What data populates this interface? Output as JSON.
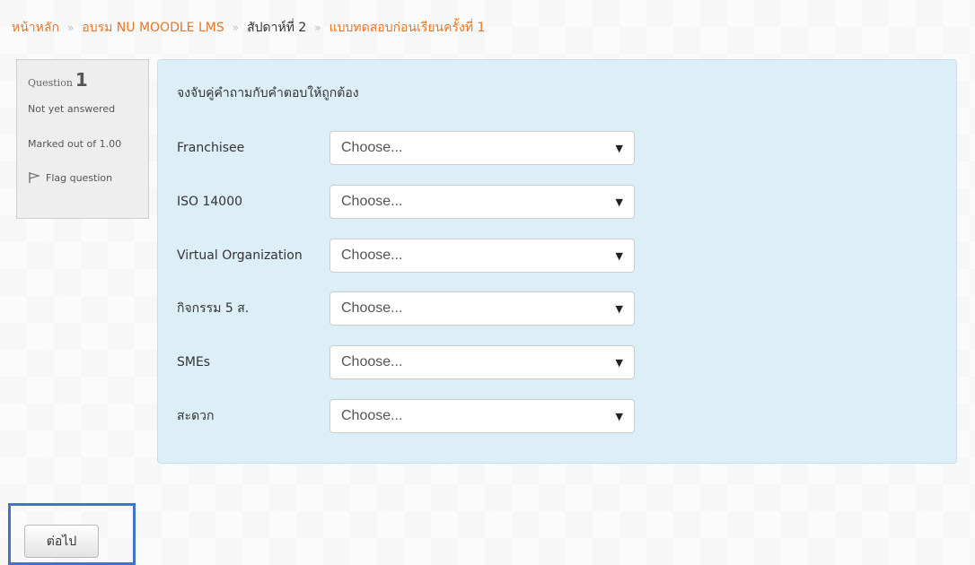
{
  "breadcrumb": {
    "items": [
      "หน้าหลัก",
      "อบรม NU MOODLE LMS",
      "สัปดาห์ที่ 2",
      "แบบทดสอบก่อนเรียนครั้งที่ 1"
    ],
    "separator": "»"
  },
  "question_info": {
    "title_label": "Question",
    "number": "1",
    "state": "Not yet answered",
    "mark": "Marked out of 1.00",
    "flag_label": "Flag question"
  },
  "question": {
    "prompt": "จงจับคู่คำถามกับคำตอบให้ถูกต้อง",
    "rows": [
      {
        "term": "Franchisee",
        "selected": "Choose..."
      },
      {
        "term": "ISO 14000",
        "selected": "Choose..."
      },
      {
        "term": "Virtual Organization",
        "selected": "Choose..."
      },
      {
        "term": "กิจกรรม 5 ส.",
        "selected": "Choose..."
      },
      {
        "term": "SMEs",
        "selected": "Choose..."
      },
      {
        "term": "สะดวก",
        "selected": "Choose..."
      }
    ]
  },
  "navigation": {
    "next_label": "ต่อไป"
  },
  "colors": {
    "link": "#e8772a",
    "content_bg": "#dceef6",
    "highlight": "#4472c4"
  }
}
